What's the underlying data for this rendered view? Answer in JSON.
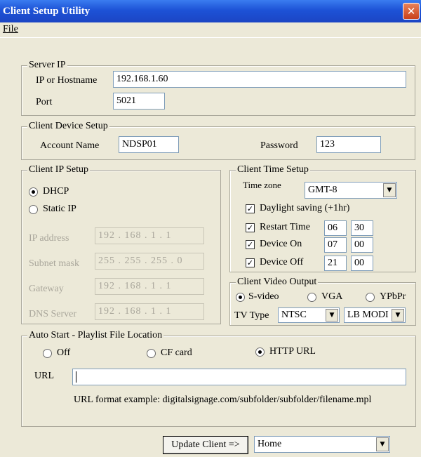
{
  "window": {
    "title": "Client Setup Utility",
    "close_glyph": "✕"
  },
  "menu": {
    "file": "File"
  },
  "server_ip": {
    "legend": "Server IP",
    "host_label": "IP or Hostname",
    "host_value": "192.168.1.60",
    "port_label": "Port",
    "port_value": "5021"
  },
  "device_setup": {
    "legend": "Client Device Setup",
    "account_label": "Account Name",
    "account_value": "NDSP01",
    "password_label": "Password",
    "password_value": "123"
  },
  "ip_setup": {
    "legend": "Client IP Setup",
    "dhcp": "DHCP",
    "static": "Static IP",
    "ip_label": "IP address",
    "ip_value": "192 . 168 . 1 . 1",
    "mask_label": "Subnet mask",
    "mask_value": "255 . 255 . 255 . 0",
    "gw_label": "Gateway",
    "gw_value": "192 . 168 . 1 . 1",
    "dns_label": "DNS Server",
    "dns_value": "192 . 168 . 1 . 1"
  },
  "time_setup": {
    "legend": "Client Time Setup",
    "tz_label": "Time zone",
    "tz_value": "GMT-8",
    "daylight": "Daylight saving (+1hr)",
    "restart": "Restart Time",
    "restart_h": "06",
    "restart_m": "30",
    "on": "Device On",
    "on_h": "07",
    "on_m": "00",
    "off": "Device Off",
    "off_h": "21",
    "off_m": "00"
  },
  "video": {
    "legend": "Client Video Output",
    "svideo": "S-video",
    "vga": "VGA",
    "ypbpr": "YPbPr",
    "tv_label": "TV Type",
    "tv_value": "NTSC",
    "mode_value": "LB MODI"
  },
  "autostart": {
    "legend": "Auto Start - Playlist File Location",
    "off": "Off",
    "cf": "CF card",
    "http": "HTTP URL",
    "url_label": "URL",
    "url_value": "",
    "example": "URL format example: digitalsignage.com/subfolder/subfolder/filename.mpl"
  },
  "footer": {
    "update_label": "Update Client =>",
    "target_value": "Home"
  }
}
